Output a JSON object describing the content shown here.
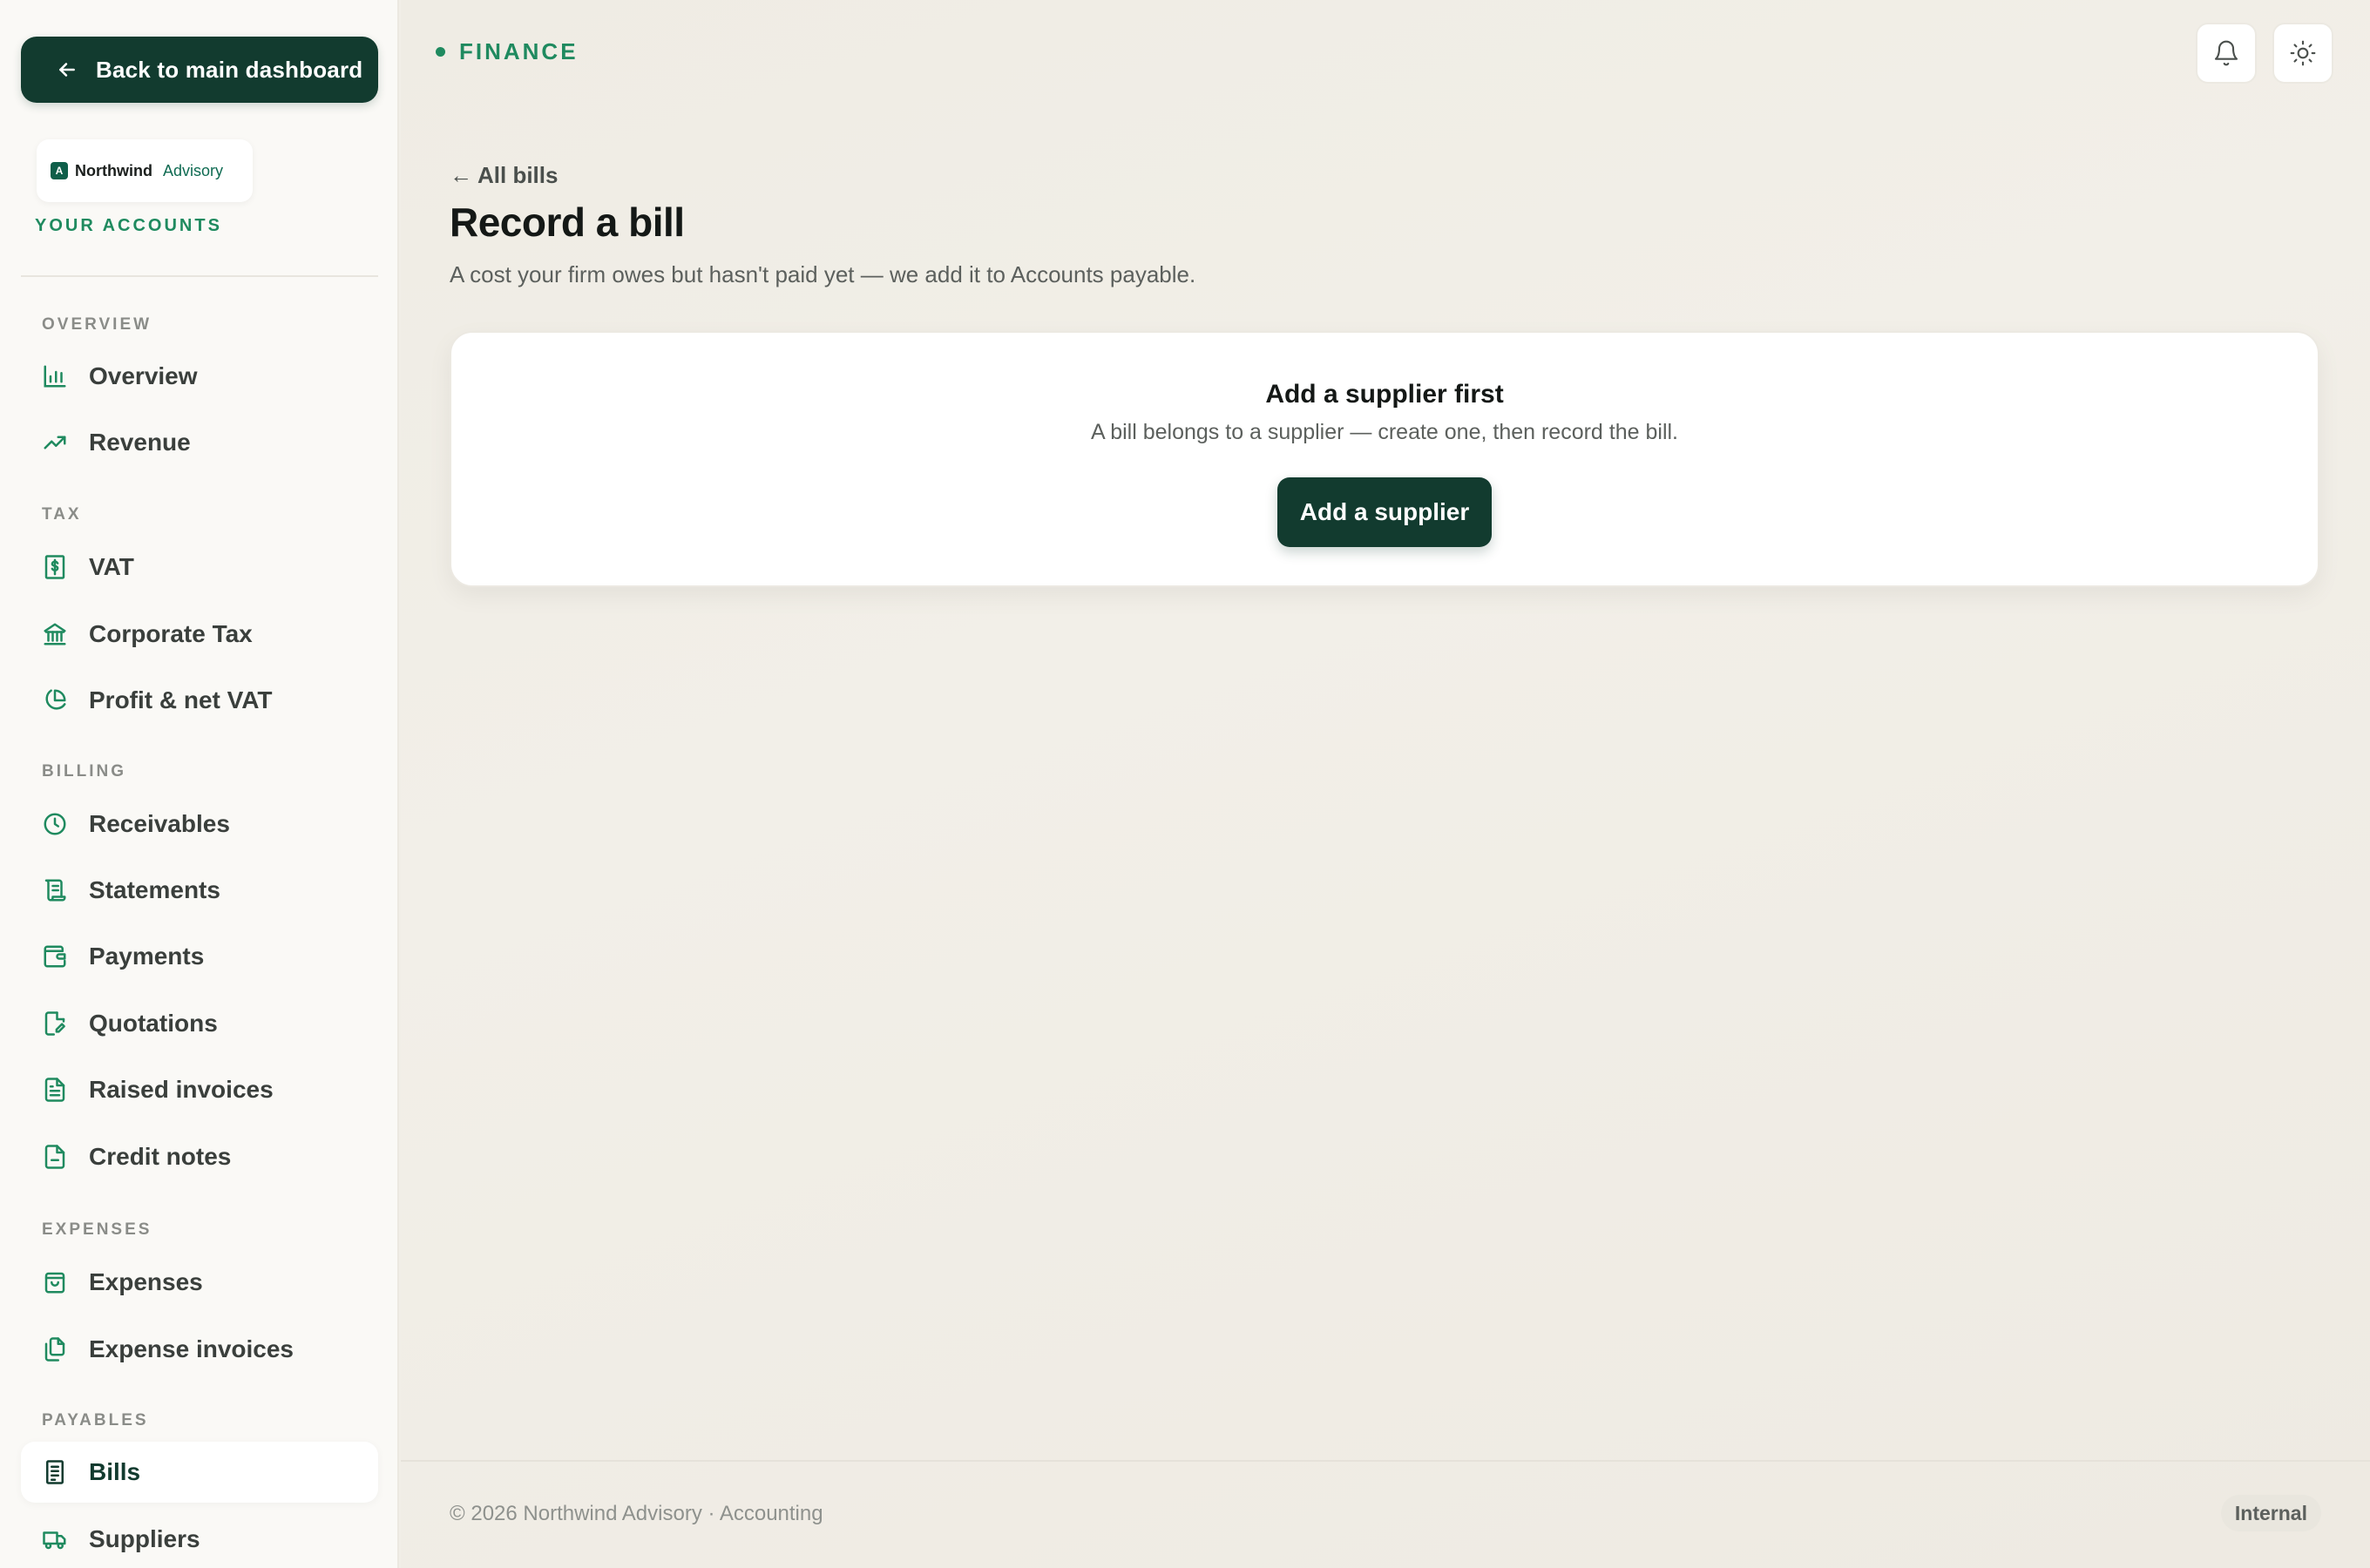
{
  "colors": {
    "accent_dark": "#123b2f",
    "accent_green": "#1f8a5f",
    "background": "#f1eee7"
  },
  "sidebar": {
    "back_button": {
      "label": "Back to main dashboard",
      "icon": "arrow-left-icon"
    },
    "brand": {
      "mark": "A",
      "name": "Northwind",
      "sub": "Advisory"
    },
    "accounts_label": "YOUR ACCOUNTS",
    "sections": {
      "overview": "OVERVIEW",
      "tax": "TAX",
      "billing": "BILLING",
      "expenses": "EXPENSES",
      "payables": "PAYABLES"
    },
    "items": {
      "overview": {
        "label": "Overview",
        "icon": "bar-chart-icon"
      },
      "revenue": {
        "label": "Revenue",
        "icon": "trending-up-icon"
      },
      "vat": {
        "label": "VAT",
        "icon": "receipt-dollar-icon"
      },
      "corporate_tax": {
        "label": "Corporate Tax",
        "icon": "bank-icon"
      },
      "profit_vat": {
        "label": "Profit & net VAT",
        "icon": "pie-chart-icon"
      },
      "receivables": {
        "label": "Receivables",
        "icon": "clock-icon"
      },
      "statements": {
        "label": "Statements",
        "icon": "scroll-icon"
      },
      "payments": {
        "label": "Payments",
        "icon": "wallet-icon"
      },
      "quotations": {
        "label": "Quotations",
        "icon": "file-edit-icon"
      },
      "raised_invoices": {
        "label": "Raised invoices",
        "icon": "file-text-icon"
      },
      "credit_notes": {
        "label": "Credit notes",
        "icon": "file-minus-icon"
      },
      "expenses": {
        "label": "Expenses",
        "icon": "shopping-bag-icon"
      },
      "expense_invoices": {
        "label": "Expense invoices",
        "icon": "files-icon"
      },
      "bills": {
        "label": "Bills",
        "icon": "receipt-icon",
        "active": true
      },
      "suppliers": {
        "label": "Suppliers",
        "icon": "truck-icon"
      }
    }
  },
  "header": {
    "section": "FINANCE",
    "notifications_icon": "bell-icon",
    "theme_icon": "sun-icon"
  },
  "main": {
    "back_link": "All bills",
    "back_arrow": "←",
    "title": "Record a bill",
    "subtitle": "A cost your firm owes but hasn't paid yet — we add it to Accounts payable.",
    "empty_state": {
      "title": "Add a supplier first",
      "text": "A bill belongs to a supplier — create one, then record the bill.",
      "button": "Add a supplier"
    }
  },
  "footer": {
    "copyright": "© 2026 Northwind Advisory · Accounting",
    "badge": "Internal"
  }
}
